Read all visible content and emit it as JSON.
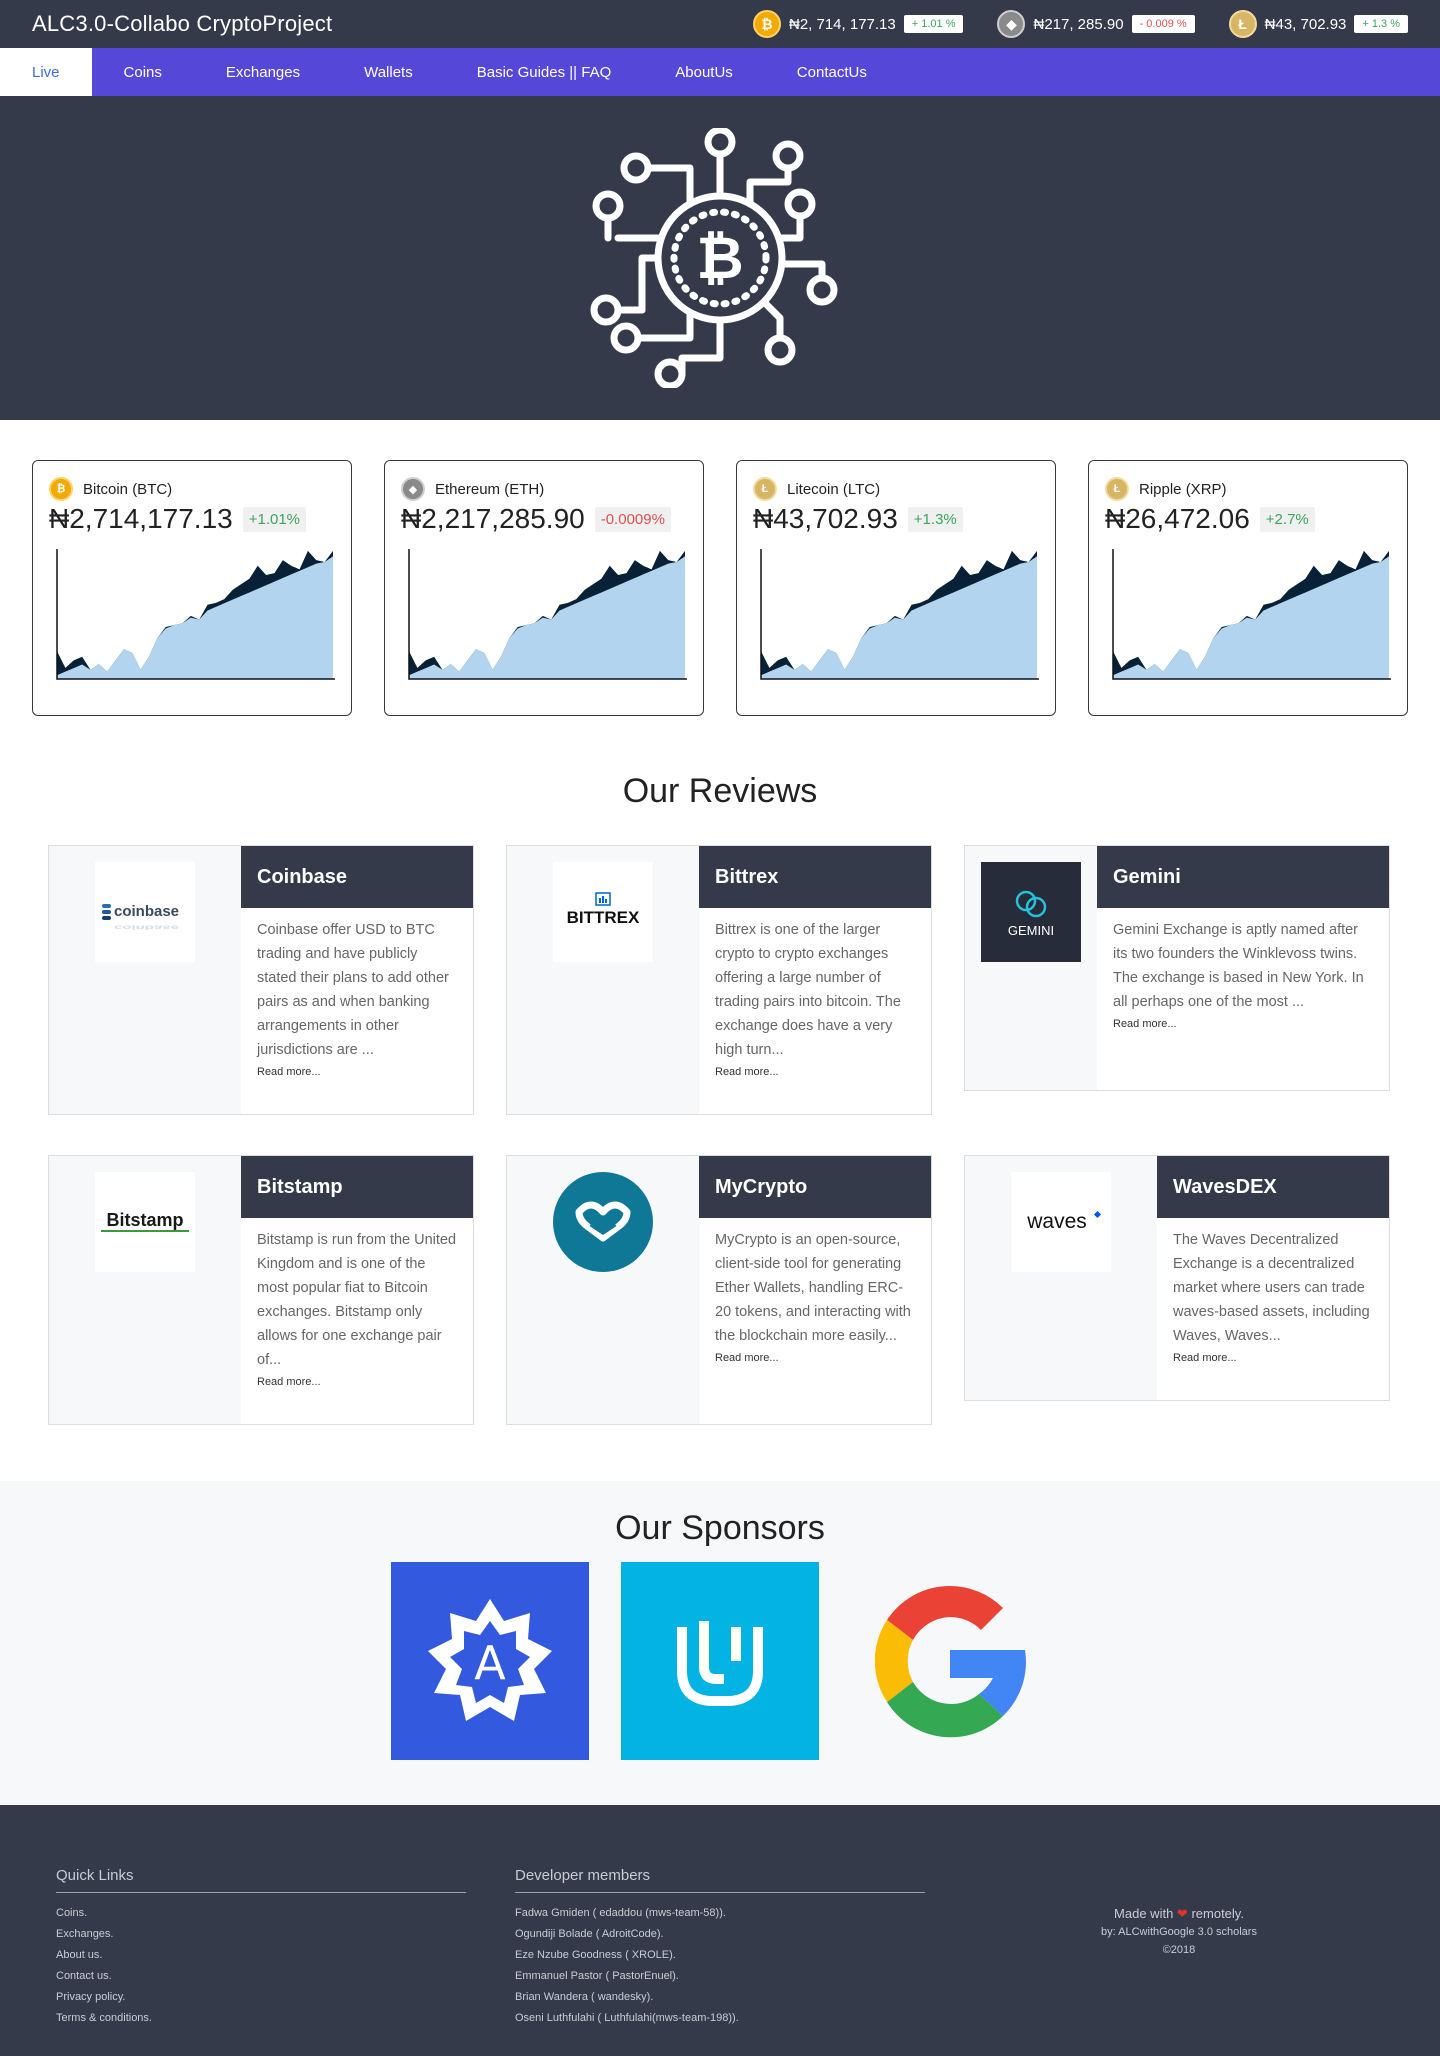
{
  "app": {
    "title": "ALC3.0-Collabo CryptoProject"
  },
  "ticker": [
    {
      "symbol": "BTC",
      "glyph": "₿",
      "price": "₦2, 714, 177.13",
      "change": "+ 1.01 %",
      "dir": "up"
    },
    {
      "symbol": "ETH",
      "glyph": "◆",
      "price": "₦217, 285.90",
      "change": "- 0.009 %",
      "dir": "down"
    },
    {
      "symbol": "LTC",
      "glyph": "Ł",
      "price": "₦43, 702.93",
      "change": "+ 1.3 %",
      "dir": "up"
    }
  ],
  "nav": {
    "items": [
      "Live",
      "Coins",
      "Exchanges",
      "Wallets",
      "Basic Guides || FAQ",
      "AboutUs",
      "ContactUs"
    ]
  },
  "cards": [
    {
      "name": "Bitcoin (BTC)",
      "glyph": "₿",
      "price": "₦2,714,177.13",
      "change": "+1.01%",
      "dir": "up"
    },
    {
      "name": "Ethereum (ETH)",
      "glyph": "◆",
      "price": "₦2,217,285.90",
      "change": "-0.0009%",
      "dir": "down"
    },
    {
      "name": "Litecoin (LTC)",
      "glyph": "Ł",
      "price": "₦43,702.93",
      "change": "+1.3%",
      "dir": "up"
    },
    {
      "name": "Ripple (XRP)",
      "glyph": "Ł",
      "price": "₦26,472.06",
      "change": "+2.7%",
      "dir": "up"
    }
  ],
  "reviews": {
    "title": "Our Reviews",
    "items": [
      {
        "name": "Coinbase",
        "logo": "coinbase",
        "text": "Coinbase offer USD to BTC trading and have publicly stated their plans to add other pairs as and when banking arrangements in other jurisdictions are ...",
        "more": "Read more..."
      },
      {
        "name": "Bittrex",
        "logo": "BITTREX",
        "text": "Bittrex is one of the larger crypto to crypto exchanges offering a large number of trading pairs into bitcoin. The exchange does have a very high turn...",
        "more": "Read more..."
      },
      {
        "name": "Gemini",
        "logo": "GEMINI",
        "text": "Gemini Exchange is aptly named after its two founders the Winklevoss twins. The exchange is based in New York. In all perhaps one of the most ...",
        "more": "Read more..."
      },
      {
        "name": "Bitstamp",
        "logo": "Bitstamp",
        "text": "Bitstamp is run from the United Kingdom and is one of the most popular fiat to Bitcoin exchanges. Bitstamp only allows for one exchange pair of...",
        "more": "Read more..."
      },
      {
        "name": "MyCrypto",
        "logo": "mycrypto",
        "text": "MyCrypto is an open-source, client-side tool for generating Ether Wallets, handling ERC-20 tokens, and interacting with the blockchain more easily...",
        "more": "Read more..."
      },
      {
        "name": "WavesDEX",
        "logo": "waves",
        "text": "The Waves Decentralized Exchange is a decentralized market where users can trade waves-based assets, including Waves, Waves...",
        "more": "Read more..."
      }
    ]
  },
  "sponsors": {
    "title": "Our Sponsors",
    "items": [
      {
        "name": "Andela",
        "color": "#3359df",
        "letter": "A"
      },
      {
        "name": "Udacity",
        "color": "#02b3e4",
        "letter": "U"
      },
      {
        "name": "Google",
        "color": "#ffffff",
        "letter": "G"
      }
    ]
  },
  "footer": {
    "quick_links_title": "Quick Links",
    "quick_links": [
      "Coins.",
      "Exchanges.",
      "About us.",
      "Contact us.",
      "Privacy policy.",
      "Terms & conditions."
    ],
    "devs_title": "Developer members",
    "devs": [
      "Fadwa Gmiden ( edaddou (mws-team-58)).",
      "Ogundiji Bolade ( AdroitCode).",
      "Eze Nzube Goodness ( XROLE).",
      "Emmanuel Pastor ( PastorEnuel).",
      "Brian Wandera ( wandesky).",
      "Oseni Luthfulahi ( Luthfulahi(mws-team-198))."
    ],
    "made_prefix": "Made with",
    "made_suffix": "remotely.",
    "by": "by: ALCwithGoogle 3.0 scholars",
    "copyright": "©2018"
  },
  "colors": {
    "header_bg": "#343a4a",
    "nav_bg": "#5548d9",
    "up": "#3aa55b",
    "down": "#d9534f",
    "chart_fill": "#b3d4ee",
    "chart_dark": "#082137"
  }
}
